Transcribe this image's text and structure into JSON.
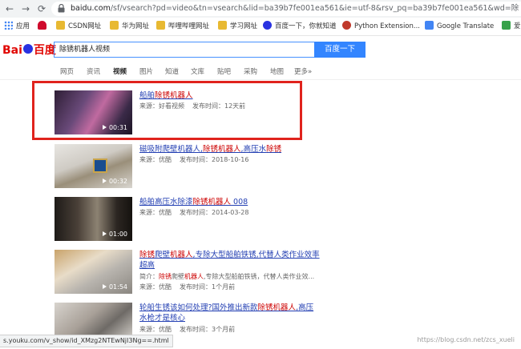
{
  "browser": {
    "url_host": "baidu.com",
    "url_rest": "/sf/vsearch?pd=video&tn=vsearch&lid=ba39b7fe001ea561&ie=utf-8&rsv_pq=ba39b7fe001ea561&wd=除锈机器..."
  },
  "bookmarks": [
    {
      "label": "应用",
      "icon": "apps-icon"
    },
    {
      "label": "",
      "icon": "huawei-icon"
    },
    {
      "label": "CSDN网址",
      "icon": "folder-icon"
    },
    {
      "label": "华为网址",
      "icon": "folder-icon"
    },
    {
      "label": "哔哩哔哩网址",
      "icon": "folder-icon"
    },
    {
      "label": "学习网址",
      "icon": "folder-icon"
    },
    {
      "label": "百度一下，你就知道",
      "icon": "baidu-paw-icon"
    },
    {
      "label": "Python Extension...",
      "icon": "python-icon"
    },
    {
      "label": "Google Translate",
      "icon": "translate-icon"
    },
    {
      "label": "爱",
      "icon": "green-icon"
    }
  ],
  "header": {
    "logo_left": "Bai",
    "logo_right": "百度",
    "search_value": "除锈机器人视频",
    "search_button": "百度一下"
  },
  "tabs": [
    "网页",
    "资讯",
    "视频",
    "图片",
    "知道",
    "文库",
    "贴吧",
    "采购",
    "地图",
    "更多»"
  ],
  "active_tab": "视频",
  "results": [
    {
      "title_parts": [
        [
          "船舶",
          false
        ],
        [
          "除锈机器人",
          true
        ]
      ],
      "duration": "00:31",
      "source": "来源：好看视频",
      "time": "发布时间：12天前",
      "desc": []
    },
    {
      "title_parts": [
        [
          "磁吸附爬壁机器人,",
          false
        ],
        [
          "除锈机器人",
          true
        ],
        [
          ",高压水",
          false
        ],
        [
          "除锈",
          true
        ]
      ],
      "duration": "00:32",
      "source": "来源：优酷",
      "time": "发布时间：2018-10-16",
      "desc": []
    },
    {
      "title_parts": [
        [
          "船舶高压水除漆",
          false
        ],
        [
          "除锈机器人",
          true
        ],
        [
          " 008",
          false
        ]
      ],
      "duration": "01:00",
      "source": "来源：优酷",
      "time": "发布时间：2014-03-28",
      "desc": []
    },
    {
      "title_parts": [
        [
          "除锈",
          true
        ],
        [
          "爬壁",
          false
        ],
        [
          "机器人",
          true
        ],
        [
          ",专除大型船舶铁锈,代替人类作业效率超高",
          false
        ]
      ],
      "duration": "01:54",
      "desc_parts": [
        [
          "简介：",
          false
        ],
        [
          "除锈",
          true
        ],
        [
          "爬壁",
          false
        ],
        [
          "机器人",
          true
        ],
        [
          ",专除大型船舶铁锈，代替人类作业效...",
          false
        ]
      ],
      "source": "来源：优酷",
      "time": "发布时间：1个月前"
    },
    {
      "title_parts": [
        [
          "轮船生锈该如何处理?国外推出新款",
          false
        ],
        [
          "除锈机器人",
          true
        ],
        [
          ",高压水枪才是核心",
          false
        ]
      ],
      "duration": "",
      "source": "来源：优酷",
      "time": "发布时间：3个月前",
      "desc": []
    }
  ],
  "status_bar": "s.youku.com/v_show/id_XMzg2NTEwNjI3Ng==.html",
  "watermark": "https://blog.csdn.net/zcs_xueli"
}
